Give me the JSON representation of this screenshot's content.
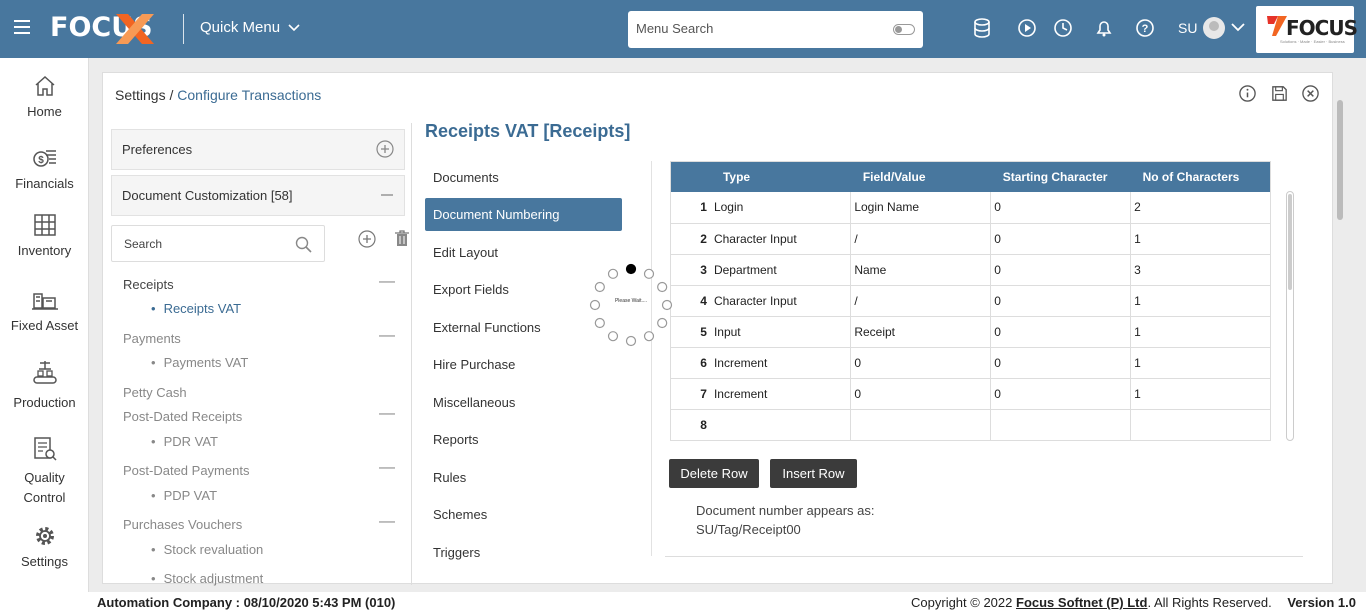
{
  "topbar": {
    "logo": "FOCUS",
    "quick_menu": "Quick Menu",
    "menu_search_placeholder": "Menu Search",
    "user": "SU",
    "brand": "FOCUS",
    "brand_tagline": "Solutions · Made · Easier · Business"
  },
  "sidebar": {
    "items": [
      {
        "label": "Home"
      },
      {
        "label": "Financials"
      },
      {
        "label": "Inventory"
      },
      {
        "label": "Fixed Asset"
      },
      {
        "label": "Production"
      },
      {
        "label": "Quality Control"
      },
      {
        "label": "Settings"
      }
    ]
  },
  "breadcrumb": {
    "root": "Settings",
    "sep": "/",
    "current": "Configure Transactions"
  },
  "left": {
    "preferences": "Preferences",
    "doc_customization": "Document Customization [58]",
    "search_placeholder": "Search",
    "tree": [
      {
        "label": "Receipts"
      },
      {
        "label": "Receipts VAT"
      },
      {
        "label": "Payments"
      },
      {
        "label": "Payments VAT"
      },
      {
        "label": "Petty Cash"
      },
      {
        "label": "Post-Dated Receipts"
      },
      {
        "label": "PDR VAT"
      },
      {
        "label": "Post-Dated Payments"
      },
      {
        "label": "PDP VAT"
      },
      {
        "label": "Purchases Vouchers"
      },
      {
        "label": "Stock revaluation"
      },
      {
        "label": "Stock adjustment"
      }
    ]
  },
  "doc_title": "Receipts VAT [Receipts]",
  "menu": [
    {
      "label": "Documents"
    },
    {
      "label": "Document Numbering"
    },
    {
      "label": "Edit Layout"
    },
    {
      "label": "Export Fields"
    },
    {
      "label": "External Functions"
    },
    {
      "label": "Hire Purchase"
    },
    {
      "label": "Miscellaneous"
    },
    {
      "label": "Reports"
    },
    {
      "label": "Rules"
    },
    {
      "label": "Schemes"
    },
    {
      "label": "Triggers"
    }
  ],
  "grid": {
    "headers": [
      "Type",
      "Field/Value",
      "Starting Character",
      "No of Characters"
    ],
    "rows": [
      {
        "n": "1",
        "type": "Login",
        "value": "Login Name",
        "start": "0",
        "count": "2"
      },
      {
        "n": "2",
        "type": "Character Input",
        "value": "/",
        "start": "0",
        "count": "1"
      },
      {
        "n": "3",
        "type": "Department",
        "value": "Name",
        "start": "0",
        "count": "3"
      },
      {
        "n": "4",
        "type": "Character Input",
        "value": "/",
        "start": "0",
        "count": "1"
      },
      {
        "n": "5",
        "type": "Input",
        "value": "Receipt",
        "start": "0",
        "count": "1"
      },
      {
        "n": "6",
        "type": "Increment",
        "value": "0",
        "start": "0",
        "count": "1"
      },
      {
        "n": "7",
        "type": "Increment",
        "value": "0",
        "start": "0",
        "count": "1"
      },
      {
        "n": "8",
        "type": "",
        "value": "",
        "start": "",
        "count": ""
      }
    ]
  },
  "buttons": {
    "delete_row": "Delete Row",
    "insert_row": "Insert Row"
  },
  "doc_number": {
    "label": "Document number appears as:",
    "value": "SU/Tag/Receipt00"
  },
  "spinner_text": "Please Wait....",
  "footer": {
    "company": "Automation Company : 08/10/2020 5:43 PM (010)",
    "copyright_prefix": "Copyright © 2022",
    "copyright_link": "Focus Softnet (P) Ltd",
    "copyright_suffix": ". All Rights Reserved.",
    "version": "Version 1.0"
  },
  "colors": {
    "topbar": "#48779e",
    "accent": "#3b6b93",
    "brand_orange": "#f26522"
  }
}
